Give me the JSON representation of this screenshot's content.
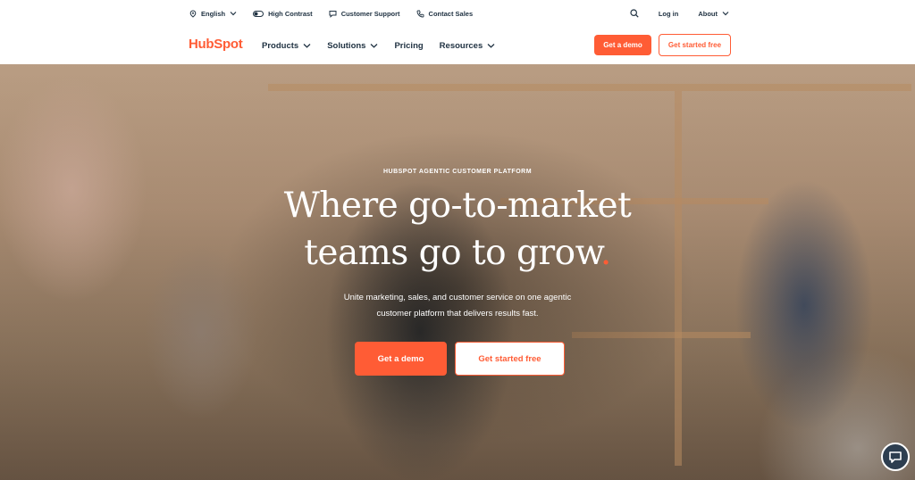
{
  "utility_bar": {
    "language": "English",
    "high_contrast": "High Contrast",
    "customer_support": "Customer Support",
    "contact_sales": "Contact Sales",
    "login": "Log in",
    "about": "About"
  },
  "nav": {
    "logo": "HubSpot",
    "items": [
      "Products",
      "Solutions",
      "Pricing",
      "Resources"
    ],
    "demo_button": "Get a demo",
    "free_button": "Get started free"
  },
  "hero": {
    "eyebrow": "HUBSPOT AGENTIC CUSTOMER PLATFORM",
    "headline_line1": "Where go-to-market",
    "headline_line2": "teams go to grow",
    "headline_dot": ".",
    "subtitle_line1": "Unite marketing, sales, and customer service on one agentic",
    "subtitle_line2": "customer platform that delivers results fast.",
    "demo_button": "Get a demo",
    "free_button": "Get started free"
  },
  "colors": {
    "brand_orange": "#ff5c35",
    "text_dark": "#213343",
    "chat_bg": "#2d3e50"
  },
  "icons": {
    "language": "globe-icon",
    "high_contrast": "toggle-icon",
    "support": "chat-bubble-icon",
    "sales": "phone-icon",
    "search": "search-icon",
    "chat": "chat-icon"
  }
}
